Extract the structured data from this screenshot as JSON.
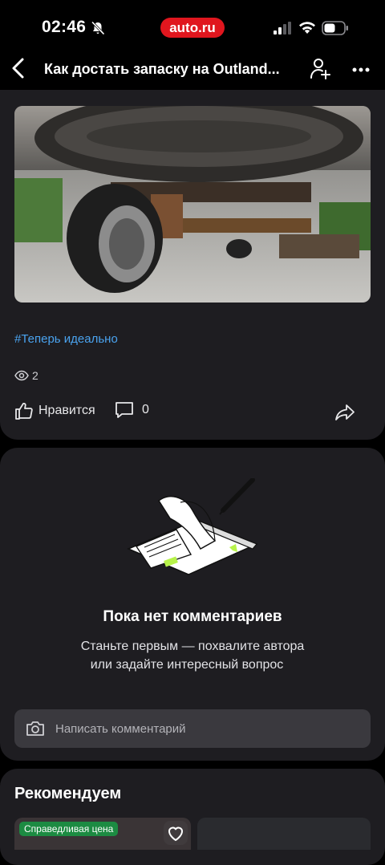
{
  "status_bar": {
    "time": "02:46",
    "brand": "auto.ru"
  },
  "header": {
    "title": "Как достать запаску на Outland..."
  },
  "post": {
    "hashtag": "#Теперь идеально",
    "views": "2",
    "like_label": "Нравится",
    "comments_count": "0"
  },
  "comments": {
    "empty_title": "Пока нет комментариев",
    "empty_line1": "Станьте первым — похвалите автора",
    "empty_line2": "или задайте интересный вопрос",
    "input_placeholder": "Написать комментарий"
  },
  "recommend": {
    "title": "Рекомендуем",
    "badge": "Справедливая цена"
  },
  "colors": {
    "accent": "#e0161e",
    "link": "#4aa3ef",
    "card": "#1e1d21",
    "badge_green": "#1c8b42"
  }
}
